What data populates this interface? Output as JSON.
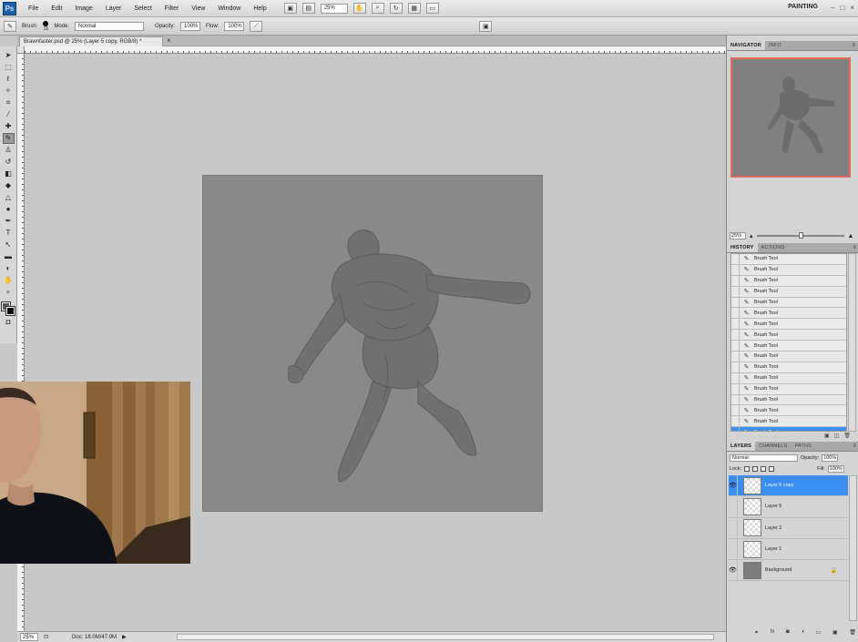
{
  "menu": {
    "logo": "Ps",
    "items": [
      "File",
      "Edit",
      "Image",
      "Layer",
      "Select",
      "Filter",
      "View",
      "Window",
      "Help"
    ],
    "zoom": "25%",
    "workspace": "PAINTING",
    "win_controls": [
      "–",
      "□",
      "×"
    ]
  },
  "options": {
    "brush_label": "Brush:",
    "brush_size": "15",
    "mode_label": "Mode:",
    "mode_value": "Normal",
    "opacity_label": "Opacity:",
    "opacity_value": "100%",
    "flow_label": "Flow:",
    "flow_value": "100%"
  },
  "document": {
    "tab_title": "Brawnfaster.psd @ 25% (Layer 5 copy, RGB/8) *",
    "close": "×"
  },
  "status": {
    "zoom": "25%",
    "doc": "Doc: 18.0M/47.9M"
  },
  "navigator": {
    "tabs": [
      "Navigator",
      "Info"
    ],
    "zoom": "25%"
  },
  "history": {
    "tabs": [
      "History",
      "Actions"
    ],
    "items": [
      "Brush Tool",
      "Brush Tool",
      "Brush Tool",
      "Brush Tool",
      "Brush Tool",
      "Brush Tool",
      "Brush Tool",
      "Brush Tool",
      "Brush Tool",
      "Brush Tool",
      "Brush Tool",
      "Brush Tool",
      "Brush Tool",
      "Brush Tool",
      "Brush Tool",
      "Brush Tool",
      "Brush Tool"
    ],
    "selected_index": 16
  },
  "layers": {
    "tabs": [
      "Layers",
      "Channels",
      "Paths"
    ],
    "blend_mode": "Normal",
    "opacity_label": "Opacity:",
    "opacity": "100%",
    "lock_label": "Lock:",
    "fill_label": "Fill:",
    "fill": "100%",
    "items": [
      {
        "name": "Layer 5 copy",
        "visible": true,
        "selected": true
      },
      {
        "name": "Layer 5",
        "visible": false,
        "selected": false
      },
      {
        "name": "Layer 2",
        "visible": false,
        "selected": false
      },
      {
        "name": "Layer 1",
        "visible": false,
        "selected": false
      },
      {
        "name": "Background",
        "visible": true,
        "selected": false
      }
    ]
  },
  "colors": {
    "accent": "#3b8ff3",
    "canvas": "#898989",
    "workspace_bg": "#c8c8c8",
    "navigator_border": "#e06a5a"
  }
}
